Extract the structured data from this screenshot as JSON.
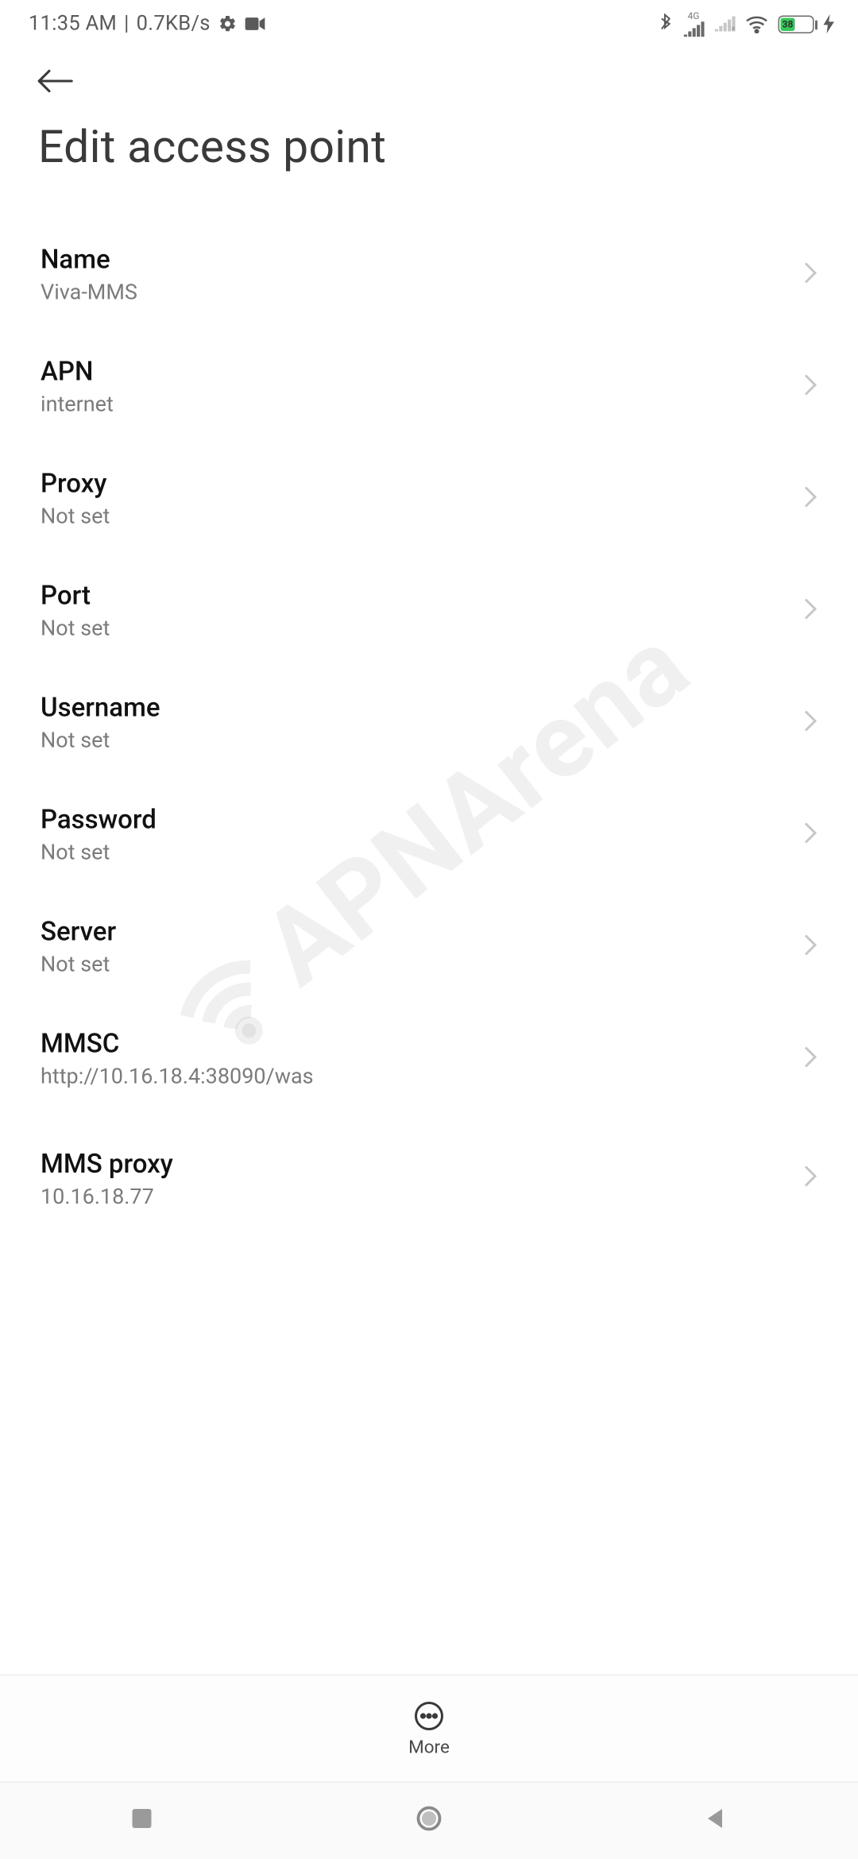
{
  "status": {
    "time": "11:35 AM",
    "sep": " | ",
    "speed": "0.7KB/s",
    "signal_label": "4G",
    "battery_pct": "38"
  },
  "header": {
    "title": "Edit access point"
  },
  "rows": [
    {
      "title": "Name",
      "value": "Viva-MMS"
    },
    {
      "title": "APN",
      "value": "internet"
    },
    {
      "title": "Proxy",
      "value": "Not set"
    },
    {
      "title": "Port",
      "value": "Not set"
    },
    {
      "title": "Username",
      "value": "Not set"
    },
    {
      "title": "Password",
      "value": "Not set"
    },
    {
      "title": "Server",
      "value": "Not set"
    },
    {
      "title": "MMSC",
      "value": "http://10.16.18.4:38090/was"
    },
    {
      "title": "MMS proxy",
      "value": "10.16.18.77"
    }
  ],
  "toolbar": {
    "more_label": "More"
  },
  "watermark": {
    "text": "APNArena"
  }
}
